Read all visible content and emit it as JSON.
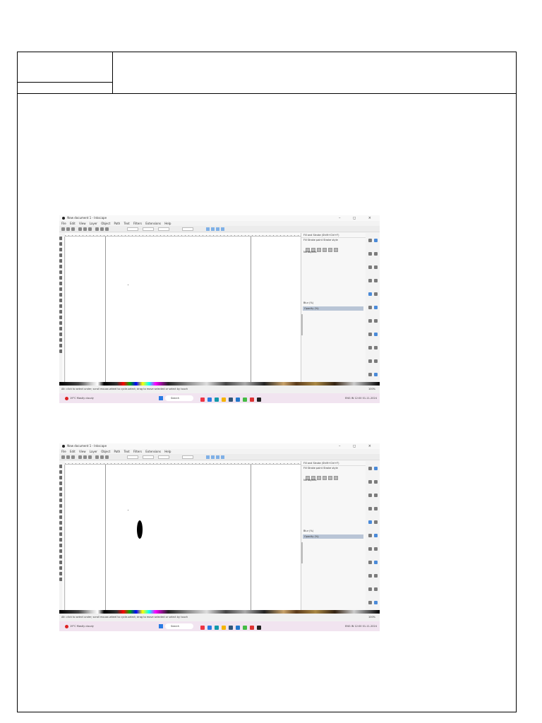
{
  "screenshots": [
    {
      "title": "New document 1 - Inkscape",
      "window_controls": "– ◻ ×",
      "menu": [
        "File",
        "Edit",
        "View",
        "Layer",
        "Object",
        "Path",
        "Text",
        "Filters",
        "Extensions",
        "Help"
      ],
      "panel": {
        "header": "Fill and Stroke (Shift+Ctrl+F)",
        "tabs": "Fill   Stroke paint   Stroke style",
        "no_objects": "No objects",
        "blur": "Blur (%)",
        "opacity": "Opacity (%)"
      },
      "status": {
        "message": "Alt: click to select under; scroll mouse-wheel to cycle-select; drag to move selected or select by touch",
        "zoom": "100%"
      },
      "taskbar": {
        "weather": "19°C  Mostly cloudy",
        "search": "Search",
        "tray": "ENG  IN   12:00  01-11-2024"
      },
      "has_ellipse": false
    },
    {
      "title": "New document 1 - Inkscape",
      "window_controls": "– ◻ ×",
      "menu": [
        "File",
        "Edit",
        "View",
        "Layer",
        "Object",
        "Path",
        "Text",
        "Filters",
        "Extensions",
        "Help"
      ],
      "panel": {
        "header": "Fill and Stroke (Shift+Ctrl+F)",
        "tabs": "Fill   Stroke paint   Stroke style",
        "no_objects": "No objects",
        "blur": "Blur (%)",
        "opacity": "Opacity (%)"
      },
      "status": {
        "message": "Alt: click to select under; scroll mouse-wheel to cycle-select; drag to move selected or select by touch",
        "zoom": "100%"
      },
      "taskbar": {
        "weather": "19°C  Mostly cloudy",
        "search": "Search",
        "tray": "ENG  IN   12:00  01-11-2024"
      },
      "has_ellipse": true
    }
  ],
  "colors": {
    "frame": "#000000",
    "page_bg": "#ffffff",
    "accent": "#4a8ad8",
    "taskbar": "#f1e4f0"
  }
}
